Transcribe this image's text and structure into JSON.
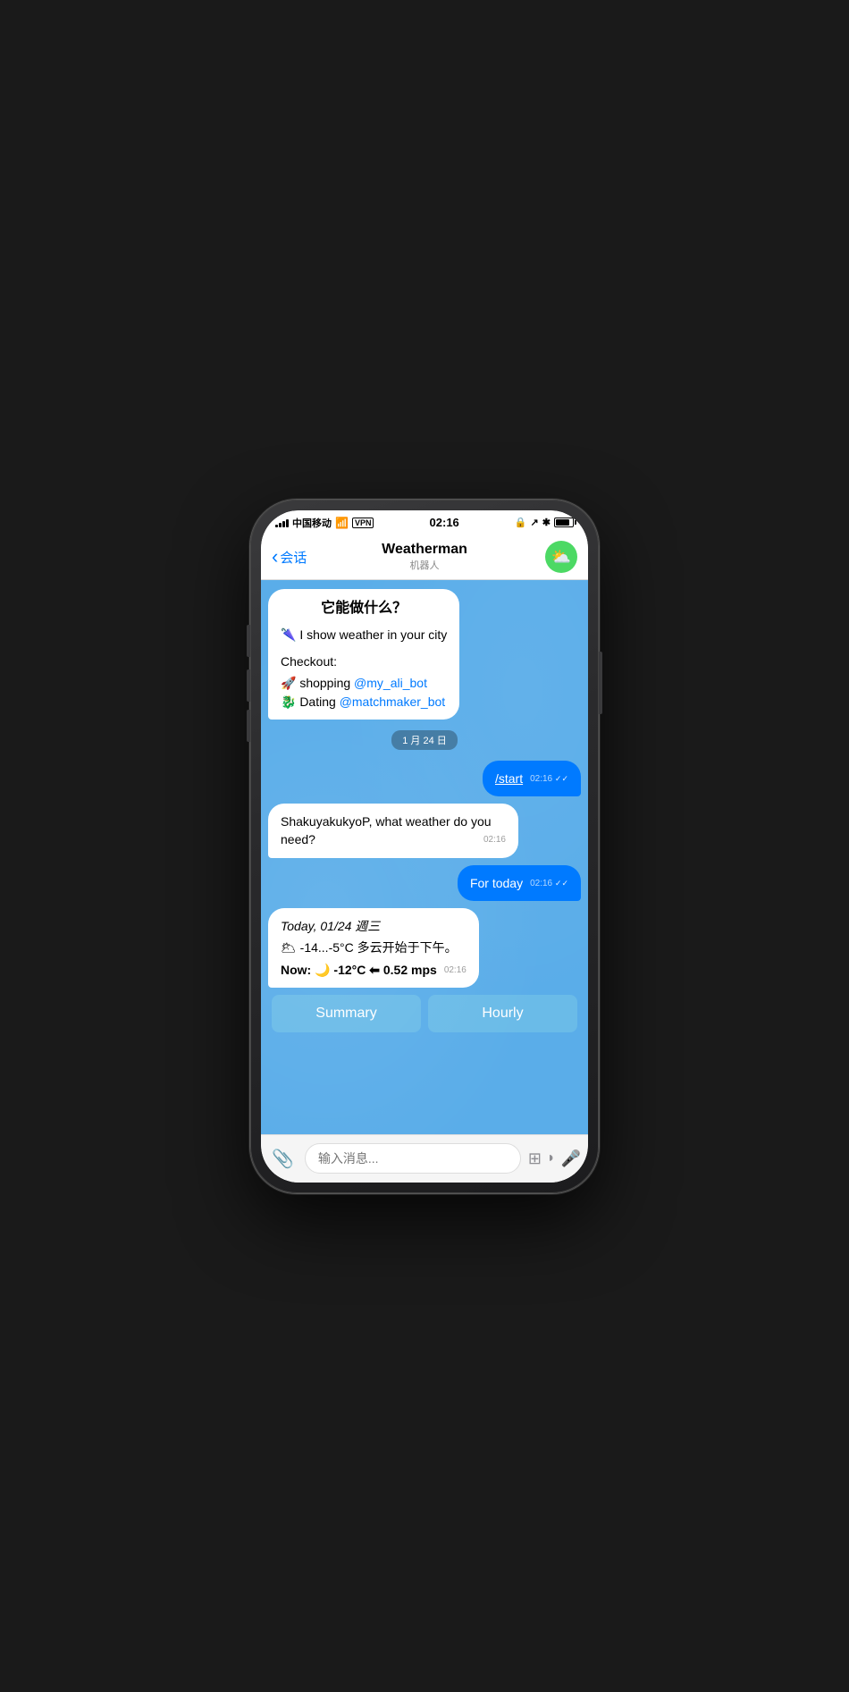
{
  "status": {
    "carrier": "中国移动",
    "wifi": "WiFi",
    "vpn": "VPN",
    "time": "02:16",
    "battery_pct": 85
  },
  "nav": {
    "back_label": "会话",
    "title": "Weatherman",
    "subtitle": "机器人"
  },
  "chat": {
    "welcome_bubble": {
      "title": "它能做什么？",
      "line1": "🌂 I show weather in your city",
      "checkout_label": "Checkout:",
      "shopping_text": "🚀 shopping ",
      "shopping_link": "@my_ali_bot",
      "dating_text": "🐉 Dating ",
      "dating_link": "@matchmaker_bot"
    },
    "date_divider": "1 月 24 日",
    "msg_start": {
      "text": "/start",
      "time": "02:16",
      "ticks": "✓✓"
    },
    "msg_question": {
      "text": "ShakuyakukyoP, what weather do you need?",
      "time": "02:16"
    },
    "msg_today": {
      "text": "For today",
      "time": "02:16",
      "ticks": "✓✓"
    },
    "msg_weather": {
      "line1": "Today, 01/24 週三",
      "line2": "🌥 -14...-5°C 多云开始于下午。",
      "line3": "Now: 🌙 -12°C ⬅ 0.52 mps",
      "time": "02:16"
    },
    "quick_replies": {
      "summary": "Summary",
      "hourly": "Hourly"
    }
  },
  "input": {
    "placeholder": "输入消息..."
  },
  "icons": {
    "back_arrow": "‹",
    "cloud_sun": "⛅",
    "attach": "📎",
    "sticker": "⊞",
    "moon": "◗",
    "mic": "🎤"
  }
}
